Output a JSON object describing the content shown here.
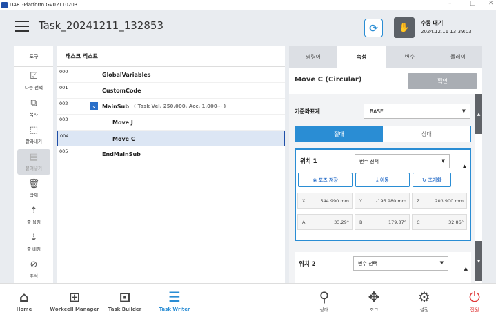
{
  "window": {
    "title": "DART-Platform GV02110203",
    "controls": [
      "–",
      "□",
      "✕"
    ]
  },
  "header": {
    "task_title": "Task_20241211_132853",
    "status_label": "수동 대기",
    "status_time": "2024.12.11 13:39:03"
  },
  "tools": {
    "title": "도구",
    "items": [
      {
        "icon": "multi-select-icon",
        "glyph": "☑",
        "label": "다중 선택"
      },
      {
        "icon": "copy-icon",
        "glyph": "⧉",
        "label": "복사"
      },
      {
        "icon": "cut-icon",
        "glyph": "⬚",
        "label": "잘라내기"
      },
      {
        "icon": "paste-icon",
        "glyph": "▤",
        "label": "붙여넣기"
      },
      {
        "icon": "delete-icon",
        "glyph": "🗑",
        "label": "삭제"
      },
      {
        "icon": "move-up-icon",
        "glyph": "⇡",
        "label": "줄 올림"
      },
      {
        "icon": "move-down-icon",
        "glyph": "⇣",
        "label": "줄 내림"
      },
      {
        "icon": "comment-icon",
        "glyph": "⊘",
        "label": "주석"
      }
    ]
  },
  "tasklist": {
    "title": "태스크 리스트",
    "rows": [
      {
        "num": "000",
        "text": "GlobalVariables"
      },
      {
        "num": "001",
        "text": "CustomCode"
      },
      {
        "num": "002",
        "text": "MainSub",
        "sub": "( Task Vel. 250.000, Acc. 1,000⋯ )"
      },
      {
        "num": "003",
        "text": "Move J"
      },
      {
        "num": "004",
        "text": "Move C"
      },
      {
        "num": "005",
        "text": "EndMainSub"
      }
    ]
  },
  "props": {
    "tabs": [
      "명령어",
      "속성",
      "변수",
      "플레이"
    ],
    "command_title": "Move C (Circular)",
    "confirm_label": "확인",
    "frame_label": "기준좌표계",
    "frame_value": "BASE",
    "toggle": {
      "absolute": "절대",
      "relative": "상대"
    },
    "pos1": {
      "label": "위치 1",
      "var_select": "변수 선택",
      "btn_save": "포즈 저장",
      "btn_move": "이동",
      "btn_reset": "초기화",
      "coords": [
        {
          "k": "X",
          "v": "544.990 mm"
        },
        {
          "k": "Y",
          "v": "-195.980 mm"
        },
        {
          "k": "Z",
          "v": "203.900 mm"
        },
        {
          "k": "A",
          "v": "33.29°"
        },
        {
          "k": "B",
          "v": "179.87°"
        },
        {
          "k": "C",
          "v": "32.86°"
        }
      ]
    },
    "pos2": {
      "label": "위치 2",
      "var_select": "변수 선택"
    }
  },
  "bottom_nav": [
    {
      "label": "Home",
      "icon": "home-icon"
    },
    {
      "label": "Workcell Manager",
      "icon": "workcell-icon"
    },
    {
      "label": "Task Builder",
      "icon": "task-builder-icon"
    },
    {
      "label": "Task Writer",
      "icon": "task-writer-icon"
    },
    {
      "label": "상태",
      "icon": "status-icon"
    },
    {
      "label": "조그",
      "icon": "jog-icon"
    },
    {
      "label": "설정",
      "icon": "settings-icon"
    },
    {
      "label": "전원",
      "icon": "power-icon"
    }
  ]
}
